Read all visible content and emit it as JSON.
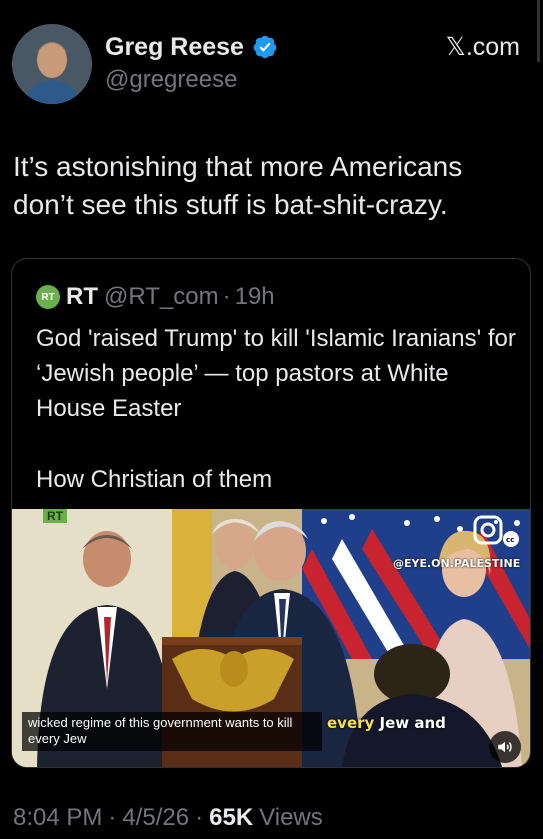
{
  "author": {
    "name": "Greg Reese",
    "handle": "@gregreese",
    "verified_icon": "verified-badge-icon",
    "verified_color": "#1d9bf0"
  },
  "site": "𝕏.com",
  "tweet": {
    "text": "It’s astonishing that more Americans don’t see this stuff is bat-shit-crazy."
  },
  "quote": {
    "logo": "RT",
    "name": "RT",
    "handle": "@RT_com",
    "separator": "·",
    "time": "19h",
    "body": "God 'raised Trump' to kill 'Islamic Iranians' for ‘Jewish people’ — top pastors at White House Easter",
    "extra": "How Christian of them",
    "video": {
      "channel_tag": "RT",
      "watermark": "@EYE.ON.PALESTINE",
      "caption": "wicked regime of this government wants to kill every Jew",
      "subtitle_prefix": "",
      "subtitle_highlight": "every",
      "subtitle_suffix": " Jew and",
      "sound_icon": "speaker-icon",
      "cc_icon": "instagram-cc-icon"
    }
  },
  "footer": {
    "time": "8:04 PM",
    "sep1": "·",
    "date": "4/5/26",
    "sep2": "·",
    "views_count": "65K",
    "views_label": "Views"
  }
}
